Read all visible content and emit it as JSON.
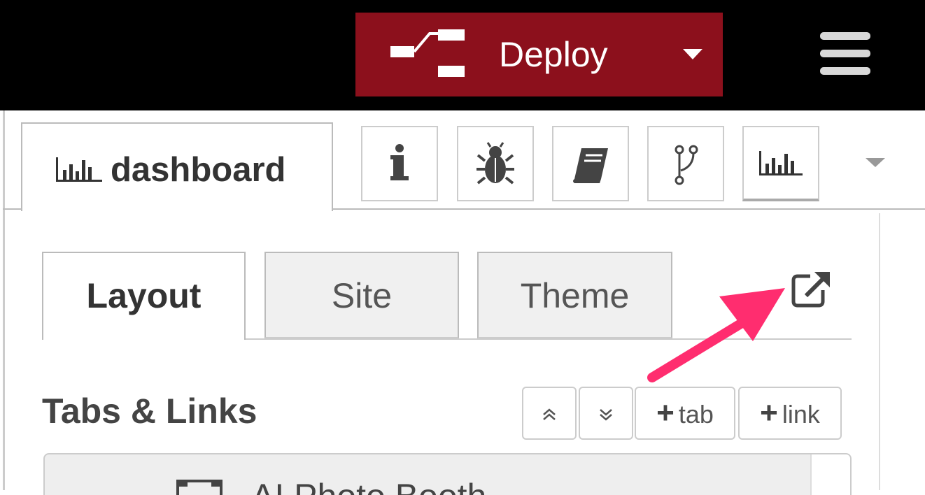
{
  "header": {
    "deploy_label": "Deploy",
    "deploy_icon": "deploy-flow-icon",
    "menu_icon": "hamburger-menu-icon",
    "bg_color": "#000000",
    "deploy_color": "#8c101c"
  },
  "sidebar": {
    "active_tab_label": "dashboard",
    "tabs": [
      {
        "icon": "info-icon"
      },
      {
        "icon": "bug-icon"
      },
      {
        "icon": "book-icon"
      },
      {
        "icon": "git-branch-icon"
      },
      {
        "icon": "bar-chart-icon"
      }
    ],
    "tabs_dropdown_icon": "caret-down-icon"
  },
  "dashboard": {
    "subtabs": [
      {
        "label": "Layout",
        "active": true
      },
      {
        "label": "Site",
        "active": false
      },
      {
        "label": "Theme",
        "active": false
      }
    ],
    "popout_icon": "external-link-icon",
    "section_title": "Tabs & Links",
    "buttons": {
      "collapse_icon": "double-chevron-up-icon",
      "expand_icon": "double-chevron-down-icon",
      "add_tab_label": "tab",
      "add_link_label": "link"
    },
    "list_items": [
      {
        "label": "AI Photo Booth",
        "icon": "tab-frame-icon"
      }
    ]
  },
  "annotation": {
    "arrow_color": "#ff2d6f"
  }
}
